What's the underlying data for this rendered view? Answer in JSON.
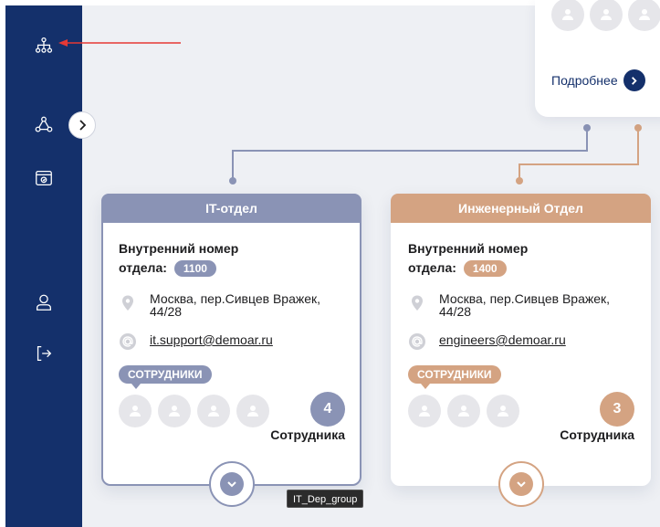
{
  "sidebar": {
    "items": [
      {
        "icon": "org-structure-icon"
      },
      {
        "icon": "network-icon"
      },
      {
        "icon": "folder-icon"
      },
      {
        "icon": "user-icon"
      },
      {
        "icon": "logout-icon"
      }
    ]
  },
  "parent_card": {
    "more_label": "Подробнее"
  },
  "departments": [
    {
      "title": "IT-отдел",
      "number_label_line1": "Внутренний номер",
      "number_label_line2": "отдела:",
      "number": "1100",
      "address": "Москва, пер.Сивцев Вражек, 44/28",
      "email": "it.support@demoar.ru",
      "staff_tag": "СОТРУДНИКИ",
      "count": "4",
      "count_label": "Сотрудника",
      "color": "#8a93b5"
    },
    {
      "title": "Инженерный Отдел",
      "number_label_line1": "Внутренний номер",
      "number_label_line2": "отдела:",
      "number": "1400",
      "address": "Москва, пер.Сивцев Вражек, 44/28",
      "email": "engineers@demoar.ru",
      "staff_tag": "СОТРУДНИКИ",
      "count": "3",
      "count_label": "Сотрудника",
      "color": "#d4a382"
    }
  ],
  "tooltip": "IT_Dep_group",
  "colors": {
    "sidebar": "#14306b",
    "it_accent": "#8a93b5",
    "eng_accent": "#d4a382",
    "annotation": "#e53935"
  }
}
